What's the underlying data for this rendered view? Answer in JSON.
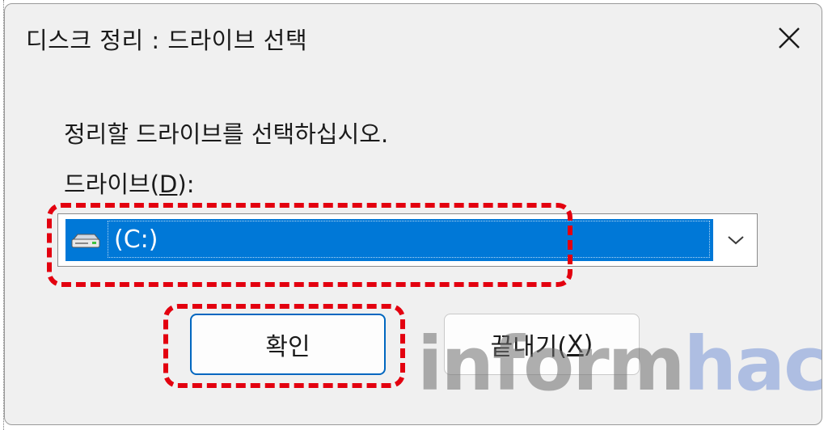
{
  "window": {
    "title": "디스크 정리 : 드라이브 선택"
  },
  "dialog": {
    "prompt": "정리할 드라이브를 선택하십시오.",
    "drive_label_prefix": "드라이브(",
    "drive_label_accel": "D",
    "drive_label_suffix": "):",
    "drive_select": {
      "selected_value": "(C:)",
      "icon": "drive-icon"
    },
    "ok_label": "확인",
    "cancel_label_prefix": "끝내기(",
    "cancel_label_accel": "X",
    "cancel_label_suffix": ")"
  },
  "watermark": {
    "part1": "inform",
    "part2": "hack"
  },
  "colors": {
    "selection": "#0078d7",
    "highlight": "#e3000f",
    "focus_border": "#0067c0"
  }
}
